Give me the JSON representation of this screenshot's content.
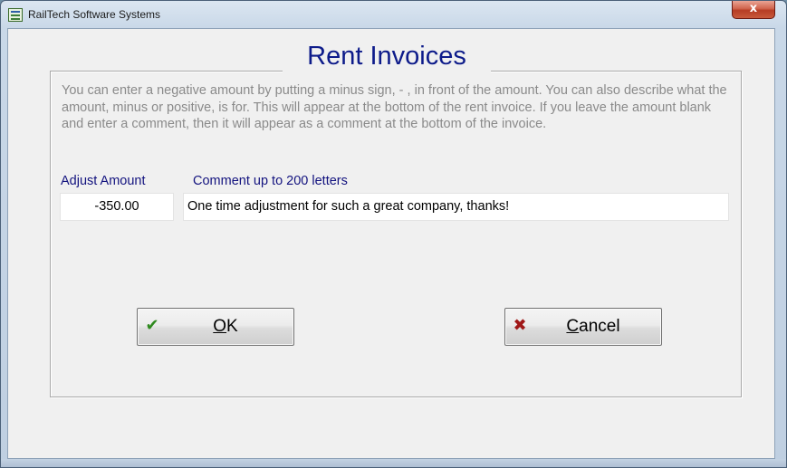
{
  "window": {
    "title": "RailTech Software Systems",
    "close_label": "x"
  },
  "dialog": {
    "heading": "Rent Invoices",
    "instructions": "You can enter a negative amount by putting a minus sign, - , in front of the amount.  You can also describe what the amount, minus or positive, is for.  This will appear at the bottom of the rent invoice.  If you leave the amount blank and enter a comment, then it will appear as a comment at the bottom of the invoice."
  },
  "form": {
    "amount_label": "Adjust Amount",
    "amount_value": "-350.00",
    "comment_label": "Comment up to 200 letters",
    "comment_value": "One time adjustment for such a great company, thanks!"
  },
  "buttons": {
    "ok": {
      "mnemonic": "O",
      "rest": "K",
      "icon": "check-icon"
    },
    "cancel": {
      "mnemonic": "C",
      "rest": "ancel",
      "icon": "cross-icon"
    }
  },
  "colors": {
    "heading": "#0d1b8a",
    "labels": "#13137f",
    "instructions": "#8a8a8a",
    "ok_icon": "#2f8a1f",
    "cancel_icon": "#a01818"
  }
}
